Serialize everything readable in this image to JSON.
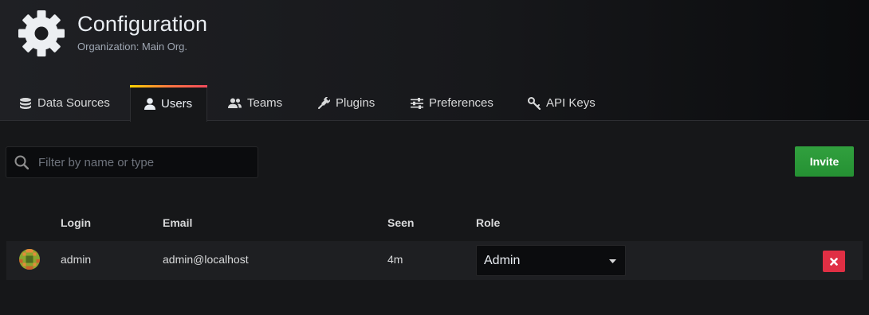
{
  "header": {
    "title": "Configuration",
    "subtitle": "Organization: Main Org.",
    "icon": "gear-icon"
  },
  "tabs": [
    {
      "label": "Data Sources",
      "icon": "database-icon",
      "active": false
    },
    {
      "label": "Users",
      "icon": "user-icon",
      "active": true
    },
    {
      "label": "Teams",
      "icon": "users-icon",
      "active": false
    },
    {
      "label": "Plugins",
      "icon": "plug-icon",
      "active": false
    },
    {
      "label": "Preferences",
      "icon": "sliders-icon",
      "active": false
    },
    {
      "label": "API Keys",
      "icon": "key-icon",
      "active": false
    }
  ],
  "search": {
    "placeholder": "Filter by name or type",
    "value": ""
  },
  "invite_label": "Invite",
  "table": {
    "columns": [
      "Login",
      "Email",
      "Seen",
      "Role"
    ],
    "rows": [
      {
        "login": "admin",
        "email": "admin@localhost",
        "seen": "4m",
        "role": "Admin"
      }
    ]
  },
  "colors": {
    "background": "#161719",
    "accent_gradient": [
      "#ffd500",
      "#ff7941",
      "#f2495c"
    ],
    "invite": "#299c39",
    "delete": "#e02f44"
  }
}
